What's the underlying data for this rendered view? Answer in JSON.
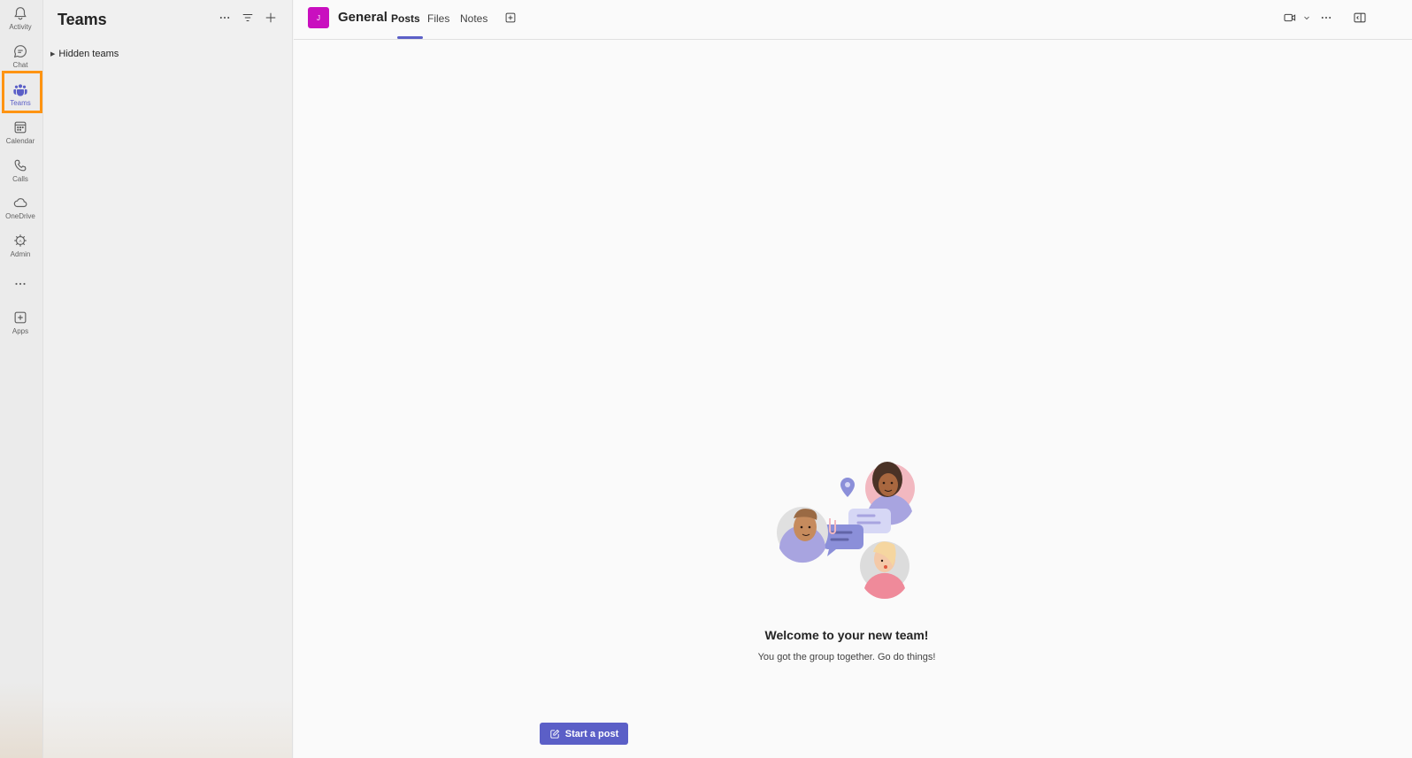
{
  "rail": {
    "items": [
      {
        "label": "Activity",
        "icon": "bell-icon"
      },
      {
        "label": "Chat",
        "icon": "chat-icon"
      },
      {
        "label": "Teams",
        "icon": "teams-icon"
      },
      {
        "label": "Calendar",
        "icon": "calendar-icon"
      },
      {
        "label": "Calls",
        "icon": "phone-icon"
      },
      {
        "label": "OneDrive",
        "icon": "cloud-icon"
      },
      {
        "label": "Admin",
        "icon": "admin-gear-icon"
      },
      {
        "label": "",
        "icon": "more-icon"
      },
      {
        "label": "Apps",
        "icon": "apps-plus-icon"
      }
    ],
    "active": "Teams",
    "highlight_color": "#ff9412"
  },
  "teams_pane": {
    "title": "Teams",
    "hidden_teams_label": "Hidden teams"
  },
  "header": {
    "team_initial": "J",
    "team_color": "#c90fbf",
    "channel_name": "General",
    "tabs": [
      {
        "label": "Posts",
        "active": true
      },
      {
        "label": "Files",
        "active": false
      },
      {
        "label": "Notes",
        "active": false
      }
    ]
  },
  "welcome": {
    "title": "Welcome to your new team!",
    "subtitle": "You got the group together. Go do things!"
  },
  "compose": {
    "start_post_label": "Start a post"
  },
  "colors": {
    "brand": "#5b5fc7",
    "annotation": "#ff9412"
  }
}
